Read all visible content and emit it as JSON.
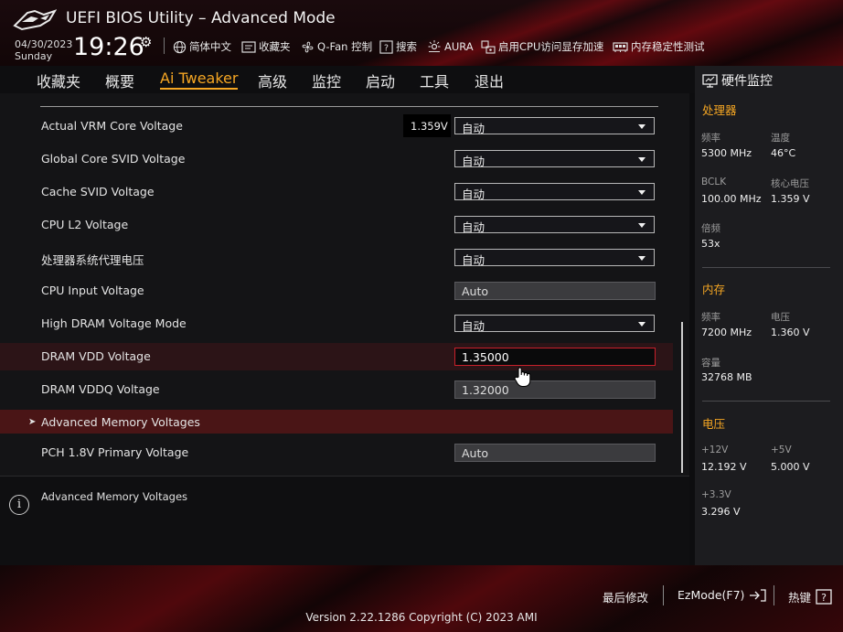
{
  "header": {
    "title": "UEFI BIOS Utility – Advanced Mode",
    "date": "04/30/2023",
    "day": "Sunday",
    "time": "19:26",
    "items": [
      {
        "icon": "globe-icon",
        "label": "简体中文"
      },
      {
        "icon": "bookmark-icon",
        "label": "收藏夹"
      },
      {
        "icon": "fan-icon",
        "label": "Q-Fan 控制"
      },
      {
        "icon": "help-box-icon",
        "label": "搜索"
      },
      {
        "icon": "aura-light-icon",
        "label": "AURA"
      },
      {
        "icon": "cpu-memory-icon",
        "label": "启用CPU访问显存加速"
      },
      {
        "icon": "memory-module-icon",
        "label": "内存稳定性测试"
      }
    ]
  },
  "tabs": [
    "收藏夹",
    "概要",
    "Ai Tweaker",
    "高级",
    "监控",
    "启动",
    "工具",
    "退出"
  ],
  "active_tab": "Ai Tweaker",
  "settings": [
    {
      "label": "Actual VRM Core Voltage",
      "value": "自动",
      "kind": "dropdown",
      "badge": "1.359V"
    },
    {
      "label": "Global Core SVID Voltage",
      "value": "自动",
      "kind": "dropdown"
    },
    {
      "label": "Cache SVID Voltage",
      "value": "自动",
      "kind": "dropdown"
    },
    {
      "label": "CPU L2 Voltage",
      "value": "自动",
      "kind": "dropdown"
    },
    {
      "label": "处理器系统代理电压",
      "value": "自动",
      "kind": "dropdown"
    },
    {
      "label": "CPU Input Voltage",
      "value": "Auto",
      "kind": "field"
    },
    {
      "label": "High DRAM Voltage Mode",
      "value": "自动",
      "kind": "dropdown"
    },
    {
      "label": "DRAM VDD Voltage",
      "value": "1.35000",
      "kind": "field-focused"
    },
    {
      "label": "DRAM VDDQ Voltage",
      "value": "1.32000",
      "kind": "field"
    },
    {
      "label": "Advanced Memory Voltages",
      "kind": "submenu"
    },
    {
      "label": "PCH 1.8V Primary Voltage",
      "value": "Auto",
      "kind": "field"
    }
  ],
  "help_text": "Advanced Memory Voltages",
  "hw_monitor": {
    "title": "硬件监控",
    "cpu": {
      "title": "处理器",
      "freq_label": "频率",
      "freq": "5300 MHz",
      "temp_label": "温度",
      "temp": "46°C",
      "bclk_label": "BCLK",
      "bclk": "100.00 MHz",
      "vcore_label": "核心电压",
      "vcore": "1.359 V",
      "ratio_label": "倍频",
      "ratio": "53x"
    },
    "memory": {
      "title": "内存",
      "freq_label": "频率",
      "freq": "7200 MHz",
      "volt_label": "电压",
      "volt": "1.360 V",
      "cap_label": "容量",
      "cap": "32768 MB"
    },
    "voltage": {
      "title": "电压",
      "v12_label": "+12V",
      "v12": "12.192 V",
      "v5_label": "+5V",
      "v5": "5.000 V",
      "v33_label": "+3.3V",
      "v33": "3.296 V"
    }
  },
  "footer": {
    "last_modified": "最后修改",
    "ezmode": "EzMode(F7)",
    "hotkeys": "热键",
    "version": "Version 2.22.1286 Copyright (C) 2023 AMI"
  },
  "colors": {
    "accent": "#f5a623",
    "brand_red": "#c8202a"
  }
}
